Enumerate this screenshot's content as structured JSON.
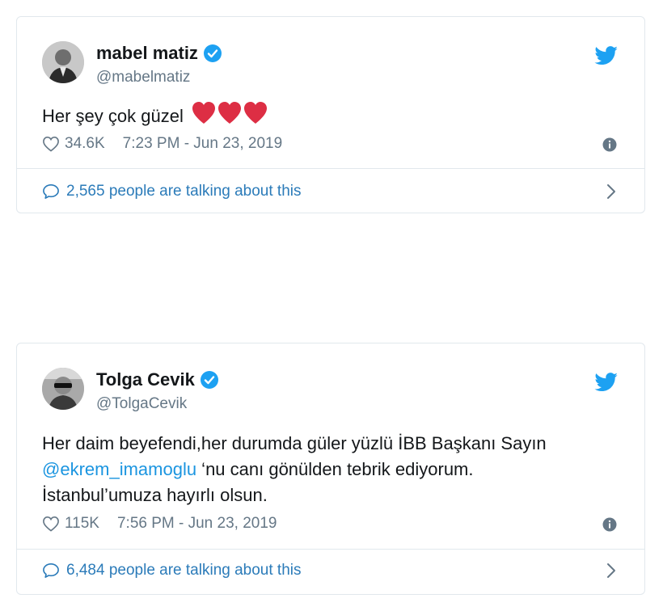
{
  "tweets": [
    {
      "name": "mabel matiz",
      "handle": "@mabelmatiz",
      "text": "Her şey çok güzel",
      "likes": "34.6K",
      "timestamp": "7:23 PM - Jun 23, 2019",
      "talking": "2,565 people are talking about this"
    },
    {
      "name": "Tolga Cevik",
      "handle": "@TolgaCevik",
      "text_part1": "Her daim beyefendi,her durumda güler yüzlü İBB Başkanı Sayın",
      "mention": "@ekrem_imamoglu",
      "text_part2": " ‘nu canı gönülden tebrik ediyorum.",
      "text_part3": "İstanbul’umuza hayırlı olsun.",
      "likes": "115K",
      "timestamp": "7:56 PM - Jun 23, 2019",
      "talking": "6,484 people are talking about this"
    }
  ],
  "colors": {
    "twitter_blue": "#1da1f2",
    "link_blue": "#1b95e0",
    "heart_red": "#e0245e",
    "meta_gray": "#657786",
    "border": "#e1e8ed"
  },
  "icons": [
    "verified-badge-icon",
    "twitter-bird-icon",
    "heart-outline-icon",
    "info-icon",
    "comment-bubble-icon",
    "chevron-right-icon",
    "red-heart-emoji"
  ]
}
